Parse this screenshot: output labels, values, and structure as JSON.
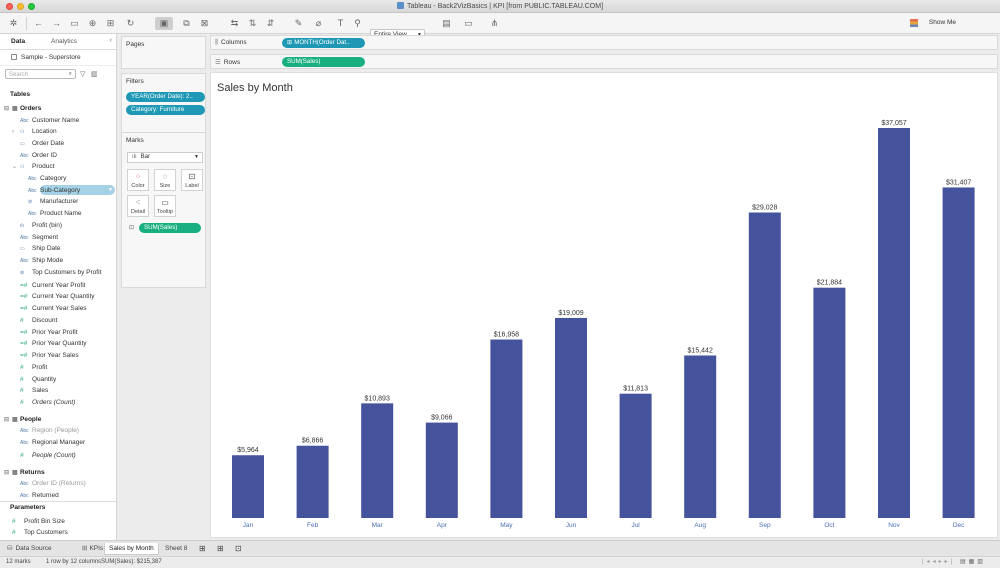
{
  "window": {
    "title": "Tableau - Back2VizBasics | KPI [from PUBLIC.TABLEAU.COM]"
  },
  "toolbar": {
    "fit": "Entire View",
    "show_me": "Show Me"
  },
  "data_pane": {
    "tabs": [
      "Data",
      "Analytics"
    ],
    "datasource": "Sample - Superstore",
    "search_placeholder": "Search",
    "tables_label": "Tables",
    "orders": {
      "label": "Orders",
      "fields": {
        "customer_name": "Customer Name",
        "location": "Location",
        "order_date": "Order Date",
        "order_id": "Order ID",
        "product": "Product",
        "category": "Category",
        "sub_category": "Sub-Category",
        "manufacturer": "Manufacturer",
        "product_name": "Product Name",
        "profit_bin": "Profit (bin)",
        "segment": "Segment",
        "ship_date": "Ship Date",
        "ship_mode": "Ship Mode",
        "top_customers": "Top Customers by Profit",
        "cy_profit": "Current Year Profit",
        "cy_quantity": "Current Year Quantity",
        "cy_sales": "Current Year Sales",
        "discount": "Discount",
        "py_profit": "Prior Year Profit",
        "py_quantity": "Prior Year Quantity",
        "py_sales": "Prior Year Sales",
        "profit": "Profit",
        "quantity": "Quantity",
        "sales": "Sales",
        "orders_count": "Orders (Count)"
      }
    },
    "people": {
      "label": "People",
      "fields": {
        "region": "Region (People)",
        "regional_manager": "Regional Manager",
        "people_count": "People (Count)"
      }
    },
    "returns": {
      "label": "Returns",
      "fields": {
        "order_id_returns": "Order ID (Returns)",
        "returned": "Returned"
      }
    },
    "parameters": {
      "label": "Parameters",
      "items": [
        "Profit Bin Size",
        "Top Customers"
      ]
    }
  },
  "cards": {
    "pages": "Pages",
    "filters": {
      "title": "Filters",
      "items": [
        "YEAR(Order Date): 2..",
        "Category: Furniture"
      ]
    },
    "marks": {
      "title": "Marks",
      "type": "Bar",
      "buttons": [
        "Color",
        "Size",
        "Label",
        "Detail",
        "Tooltip"
      ],
      "pill": "SUM(Sales)"
    }
  },
  "shelves": {
    "columns_label": "Columns",
    "columns_pill": "MONTH(Order Dat..",
    "rows_label": "Rows",
    "rows_pill": "SUM(Sales)"
  },
  "sheet": {
    "title": "Sales by Month"
  },
  "chart_data": {
    "type": "bar",
    "title": "Sales by Month",
    "categories": [
      "Jan",
      "Feb",
      "Mar",
      "Apr",
      "May",
      "Jun",
      "Jul",
      "Aug",
      "Sep",
      "Oct",
      "Nov",
      "Dec"
    ],
    "values": [
      5964,
      6866,
      10893,
      9066,
      16958,
      19009,
      11813,
      15442,
      29028,
      21884,
      37057,
      31407
    ],
    "labels": [
      "$5,964",
      "$6,866",
      "$10,893",
      "$9,066",
      "$16,958",
      "$19,009",
      "$11,813",
      "$15,442",
      "$29,028",
      "$21,884",
      "$37,057",
      "$31,407"
    ],
    "ylim": [
      0,
      40000
    ],
    "color": "#45529c",
    "label_color": "#4a6fb5",
    "grid": false
  },
  "bottom_tabs": {
    "data_source": "Data Source",
    "sheets": [
      "KPIs",
      "Sales by Month",
      "Sheet 8"
    ],
    "active": "Sales by Month"
  },
  "status": {
    "marks": "12 marks",
    "dims": "1 row by 12 columns",
    "sum": "SUM(Sales): $215,387"
  }
}
